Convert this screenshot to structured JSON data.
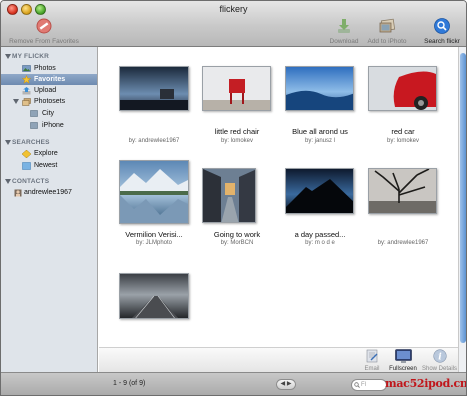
{
  "window": {
    "title": "flickery"
  },
  "toolbar": {
    "remove_label": "Remove From Favorites",
    "download_label": "Download",
    "iphoto_label": "Add to iPhoto",
    "search_label": "Search flickr"
  },
  "sidebar": {
    "my_flickr_heading": "MY FLICKR",
    "my_flickr_items": [
      {
        "label": "Photos",
        "icon": "photos-icon"
      },
      {
        "label": "Favorites",
        "icon": "star-icon",
        "selected": true
      },
      {
        "label": "Upload",
        "icon": "upload-icon"
      },
      {
        "label": "Photosets",
        "icon": "photosets-icon"
      }
    ],
    "photosets": [
      {
        "label": "City",
        "icon": "photoset-icon"
      },
      {
        "label": "iPhone",
        "icon": "photoset-icon"
      }
    ],
    "searches_heading": "SEARCHES",
    "searches_items": [
      {
        "label": "Explore",
        "icon": "explore-icon"
      },
      {
        "label": "Newest",
        "icon": "newest-icon"
      }
    ],
    "contacts_heading": "CONTACTS",
    "contacts_items": [
      {
        "label": "andrewlee1967",
        "icon": "contact-icon"
      }
    ]
  },
  "photos": [
    {
      "title": "",
      "by": "by: andrewlee1967"
    },
    {
      "title": "little red chair",
      "by": "by: lomokev"
    },
    {
      "title": "Blue all arond us",
      "by": "by: janusz l"
    },
    {
      "title": "red car",
      "by": "by: lomokev"
    },
    {
      "title": "Vermilion Verisi...",
      "by": "by: JLMphoto"
    },
    {
      "title": "Going to work",
      "by": "by: MorBCN"
    },
    {
      "title": "a day passed...",
      "by": "by: m o d e"
    },
    {
      "title": "",
      "by": "by: andrewlee1967"
    },
    {
      "title": "",
      "by": ""
    }
  ],
  "actionbar": {
    "email_label": "Email",
    "fullscreen_label": "Fullscreen",
    "details_label": "Show Details"
  },
  "statusbar": {
    "page_count": "1 - 9 (of 9)",
    "pager_glyph": "◀ ▶",
    "search_placeholder": "Fl",
    "watermark": "mac52ipod.cn"
  },
  "colors": {
    "sidebar_bg": "#dfe4ea",
    "selection": "#7390b8",
    "scroll_thumb": "#5d93d2",
    "watermark": "#c0161b"
  }
}
